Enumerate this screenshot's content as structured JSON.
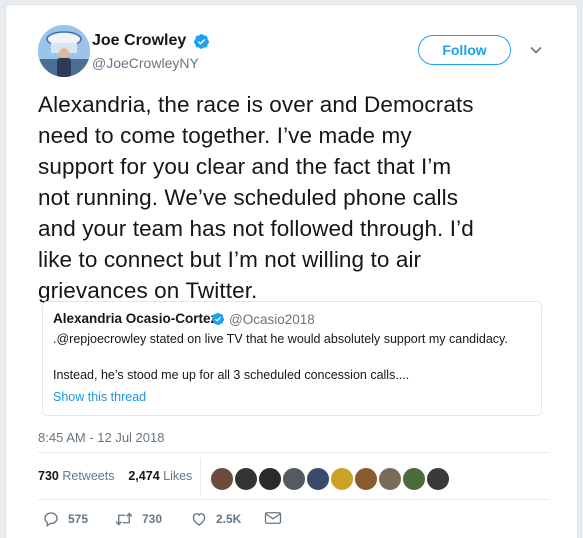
{
  "author": {
    "name": "Joe Crowley",
    "handle": "@JoeCrowleyNY"
  },
  "follow_label": "Follow",
  "tweet_lines": [
    "Alexandria, the race is over and Democrats",
    "need to come together. I’ve made my",
    "support for you clear and the fact that I’m",
    "not running. We’ve scheduled phone calls",
    "and your team has not followed through. I’d",
    "like to connect but I’m not willing to air",
    "grievances on Twitter."
  ],
  "quoted": {
    "name": "Alexandria Ocasio-Cortez",
    "handle": "@Ocasio2018",
    "line1": ".@repjoecrowley stated on live TV that he would absolutely support my candidacy.",
    "line2": "Instead, he’s stood me up for all 3 scheduled concession calls....",
    "show_thread": "Show this thread"
  },
  "timestamp": "8:45 AM - 12 Jul 2018",
  "stats": {
    "retweets_count": "730",
    "retweets_label": "Retweets",
    "likes_count": "2,474",
    "likes_label": "Likes"
  },
  "actions": {
    "reply_count": "575",
    "retweet_count": "730",
    "like_count": "2.5K"
  },
  "colors": {
    "accent": "#1da1f2",
    "verified": "#1da1f2",
    "text": "#14171a",
    "muted": "#657786"
  },
  "liker_avatar_colors": [
    "#6b4c3b",
    "#333333",
    "#2a2a2a",
    "#555a60",
    "#3b4a6b",
    "#c9a227",
    "#8b5a2b",
    "#7a6a5a",
    "#4a6b3b",
    "#3a3a3a"
  ]
}
